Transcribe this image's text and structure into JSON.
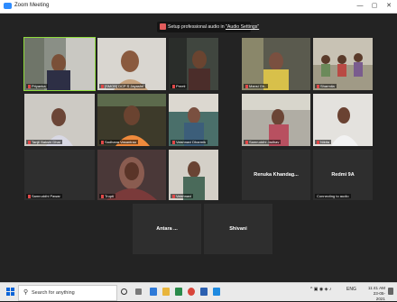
{
  "window": {
    "title": "Zoom Meeting",
    "controls": [
      "—",
      "▢",
      "✕"
    ]
  },
  "banner": {
    "prefix": "Setup professional audio in ",
    "link": "\"Audio Settings\""
  },
  "participants": [
    {
      "name": "Priyanka",
      "video": true
    },
    {
      "name": "[SMOB] DCP S Jayashri",
      "video": true
    },
    {
      "name": "Preeti",
      "video": true
    },
    {
      "name": "Mansi Gh..",
      "video": true
    },
    {
      "name": "Sharmila",
      "video": true
    },
    {
      "name": "Tanjil Bakshi Dhar",
      "video": true
    },
    {
      "name": "Sadhana Vasantrao",
      "video": true
    },
    {
      "name": "Vaishnavi Dharmik",
      "video": true
    },
    {
      "name": "Samruddhi Jadhav",
      "video": true
    },
    {
      "name": "Nikita",
      "video": true
    },
    {
      "name": "Samruddhi Pawar",
      "video": false
    },
    {
      "name": "Trupti",
      "video": true
    },
    {
      "name": "Vaishnavi",
      "video": true
    },
    {
      "name": "Renuka Khandag...",
      "video": false,
      "subtitle": ""
    },
    {
      "name": "Redmi 9A",
      "video": false,
      "subtitle": "Connecting to audio"
    },
    {
      "name": "Antara ...",
      "video": false
    },
    {
      "name": "Shivani",
      "video": false
    }
  ],
  "taskbar": {
    "search_placeholder": "Search for anything",
    "tray": {
      "lang": "ENG",
      "time": "11:41 AM",
      "date": "23-05-2021"
    }
  }
}
